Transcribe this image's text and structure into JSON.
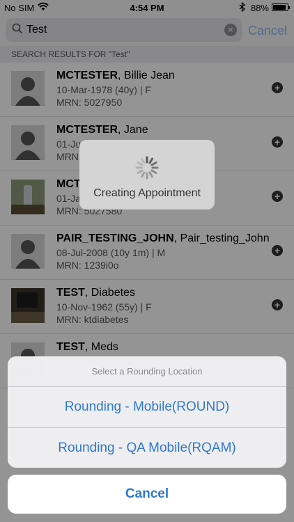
{
  "status": {
    "carrier": "No SIM",
    "time": "4:54 PM",
    "battery_pct": "88%",
    "battery_level": 0.88
  },
  "search": {
    "query": "Test",
    "cancel_label": "Cancel"
  },
  "results_header": "SEARCH RESULTS FOR \"Test\"",
  "patients": [
    {
      "last": "MCTESTER",
      "first": ", Billie Jean",
      "line2": "10-Mar-1978 (40y)  |  F",
      "line3": "MRN: 5027950"
    },
    {
      "last": "MCTESTER",
      "first": ", Jane",
      "line2": "01-Ju",
      "line3": "MRN"
    },
    {
      "last": "MCT",
      "first": "",
      "line2": "01-Ja",
      "line3": "MRN: 5027580"
    },
    {
      "last": "PAIR_TESTING_JOHN",
      "first": ", Pair_testing_John",
      "line2": "08-Jul-2008 (10y 1m)  |  M",
      "line3": "MRN: 1239i0o"
    },
    {
      "last": "TEST",
      "first": ", Diabetes",
      "line2": "10-Nov-1962 (55y)  |  F",
      "line3": "MRN: ktdiabetes"
    },
    {
      "last": "TEST",
      "first": ", Meds",
      "line2": "",
      "line3": ""
    }
  ],
  "hud": {
    "label": "Creating Appointment"
  },
  "action_sheet": {
    "title": "Select a Rounding Location",
    "options": [
      "Rounding - Mobile(ROUND)",
      "Rounding - QA Mobile(RQAM)"
    ],
    "cancel_label": "Cancel"
  },
  "colors": {
    "accent": "#2f78d4",
    "overlay": "rgba(0,0,0,0.42)"
  }
}
